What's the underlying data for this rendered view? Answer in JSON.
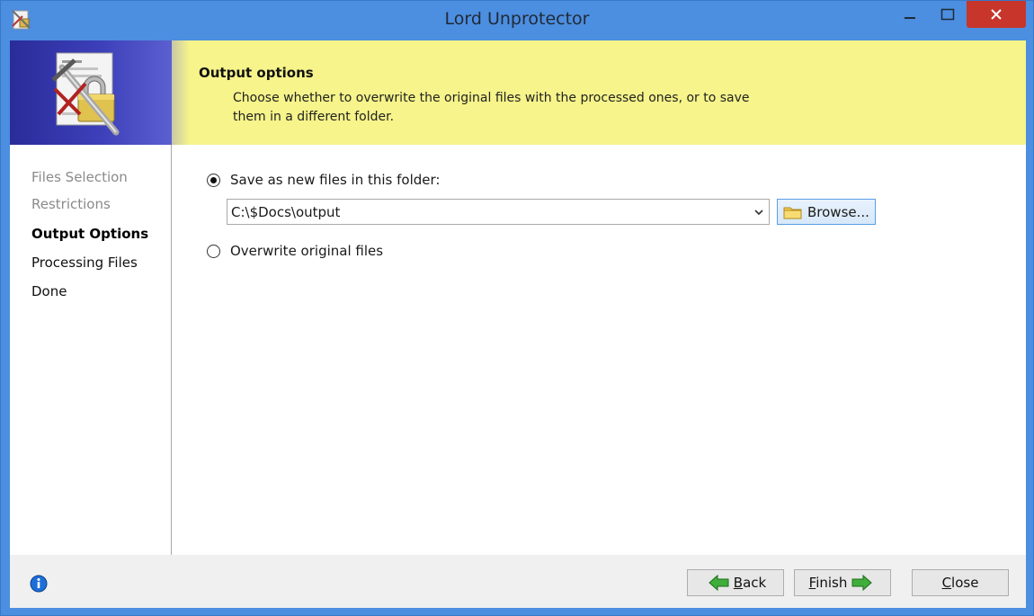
{
  "window": {
    "title": "Lord Unprotector"
  },
  "banner": {
    "title": "Output options",
    "description": "Choose whether to overwrite the original files with the processed ones, or to save them in a different folder."
  },
  "steps": [
    {
      "label": "Files Selection",
      "state": "done"
    },
    {
      "label": "Restrictions",
      "state": "done"
    },
    {
      "label": "Output Options",
      "state": "current"
    },
    {
      "label": "Processing Files",
      "state": "todo"
    },
    {
      "label": "Done",
      "state": "todo"
    }
  ],
  "output": {
    "save_new_label": "Save as new files in this folder:",
    "save_new_selected": true,
    "folder_value": "C:\\$Docs\\output",
    "browse_label": "Browse...",
    "overwrite_label": "Overwrite original files",
    "overwrite_selected": false
  },
  "footer": {
    "back_label": "Back",
    "back_mnemonic": "B",
    "back_rest": "ack",
    "finish_label": "Finish",
    "finish_mnemonic": "F",
    "finish_rest": "inish",
    "close_label": "Close",
    "close_mnemonic": "C",
    "close_rest": "lose"
  },
  "icons": {
    "app": "unprotect-sword-lock-icon",
    "info": "info-icon",
    "back": "green-arrow-left-icon",
    "finish": "green-arrow-right-icon",
    "browse": "folder-icon"
  },
  "colors": {
    "titlebar": "#4c8ee0",
    "banner": "#f6f48a",
    "close_button": "#c7352b",
    "arrow_green": "#3fae3a"
  }
}
